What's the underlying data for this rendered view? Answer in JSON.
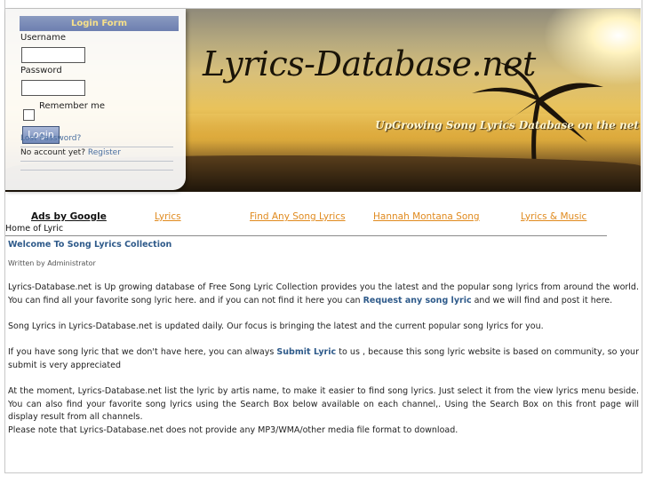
{
  "header": {
    "site_title": "Lyrics-Database.net",
    "tagline": "UpGrowing Song Lyrics Database on the net"
  },
  "login": {
    "title": "Login Form",
    "username_label": "Username",
    "username_value": "",
    "password_label": "Password",
    "password_value": "",
    "remember_label": "Remember me",
    "remember_checked": false,
    "login_button": "Login",
    "lost_password": "Lost Password?",
    "no_account": "No account yet?",
    "register": "Register"
  },
  "ads": {
    "ads_by": "Ads by Google",
    "links": [
      "Lyrics",
      "Find Any Song Lyrics",
      "Hannah Montana Song",
      "Lyrics & Music"
    ]
  },
  "breadcrumb": "Home of Lyric",
  "article": {
    "title": "Welcome To Song Lyrics Collection",
    "author": "Written by Administrator",
    "p1_a": "Lyrics-Database.net is Up growing database of Free Song Lyric Collection provides you the latest and the popular song lyrics from around the world. You can find all your favorite song lyric here. and if you can not find it here you can ",
    "p1_link": "Request any song lyric",
    "p1_b": " and we will find and  post it here.",
    "p2": "Song Lyrics in Lyrics-Database.net is updated daily. Our focus is bringing the latest and the current popular song lyrics for you.",
    "p3_a": "If you have song lyric that we don't have here, you can always ",
    "p3_link": "Submit Lyric",
    "p3_b": " to us , because this song lyric website is based on community, so your submit is very appreciated",
    "p4": "At the moment, Lyrics-Database.net list the lyric by artis name, to make it easier to find song lyrics. Just select it from the view lyrics menu beside. You can also find your favorite song lyrics using the Search Box below available on each channel,. Using the Search Box on this front page will display result from all channels.",
    "p5": "Please note that Lyrics-Database.net does not provide any MP3/WMA/other media file format to download."
  },
  "colors": {
    "link_blue": "#2e5a8a",
    "ad_orange": "#e08a1e",
    "login_title_bg": "#7c8db8"
  }
}
